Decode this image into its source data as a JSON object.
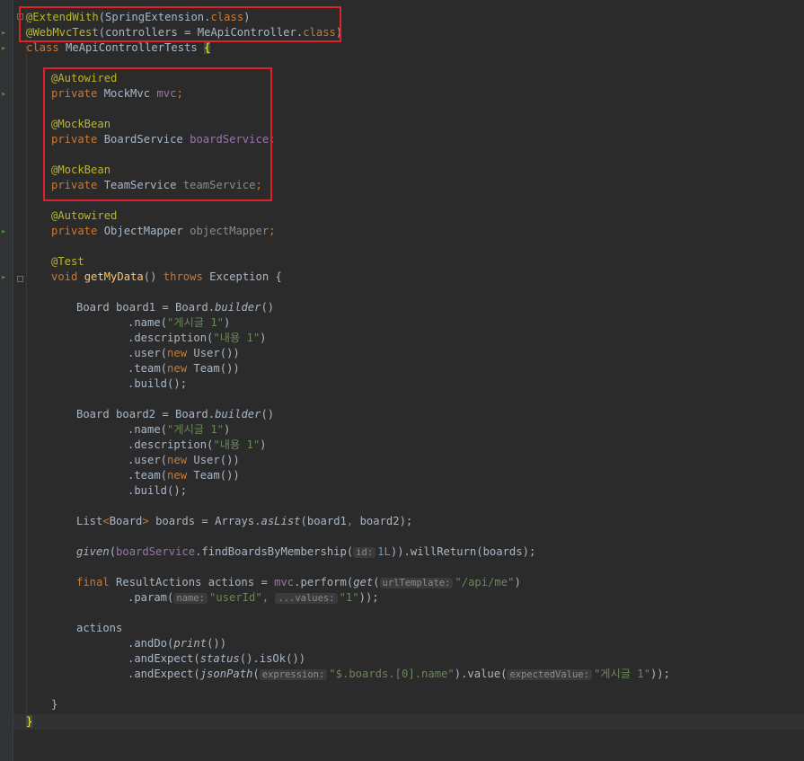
{
  "code": {
    "annotation_extend": "@ExtendWith",
    "extend_args_open": "(SpringExtension.",
    "kw_class": "class",
    "close_paren": ")",
    "annotation_webmvc": "@WebMvcTest",
    "webmvc_args": "(controllers = MeApiController.",
    "class_decl_kw": "class",
    "class_name": " MeApiControllerTests ",
    "open_brace": "{",
    "autowired": "@Autowired",
    "mockbean": "@MockBean",
    "private": "private",
    "mockmvc_type": " MockMvc ",
    "mvc_field": "mvc",
    "semicolon": ";",
    "boardservice_type": " BoardService ",
    "boardservice_field": "boardService",
    "teamservice_type": " TeamService ",
    "teamservice_field": "teamService",
    "objectmapper_type": " ObjectMapper ",
    "objectmapper_field": "objectMapper",
    "test_annotation": "@Test",
    "void": "void",
    "method_name": "getMyData",
    "method_parens": "() ",
    "throws": "throws",
    "exception": " Exception {",
    "board1_decl": "Board board1 = Board.",
    "builder": "builder",
    "parens": "()",
    "name_call": ".name(",
    "name_value": "\"게시글 1\"",
    "description_call": ".description(",
    "description_value": "\"내용 1\"",
    "user_call": ".user(",
    "new": "new",
    "user_ctor": " User())",
    "team_call": ".team(",
    "team_ctor": " Team())",
    "build_call": ".build();",
    "board2_decl": "Board board2 = Board.",
    "list_decl_1": "List",
    "lt": "<",
    "board_type": "Board",
    "gt": ">",
    "list_decl_2": " boards = Arrays.",
    "aslist": "asList",
    "aslist_args_1": "(board1",
    "comma": ",",
    "aslist_args_2": " board2);",
    "given": "given",
    "given_open": "(",
    "find_call": ".findBoardsByMembership(",
    "hint_id": "id:",
    "id_value": "1L",
    "given_close": ")).willReturn(boards);",
    "final": "final",
    "result_decl": " ResultActions actions = ",
    "perform_call": ".perform(",
    "get": "get",
    "hint_url": "urlTemplate:",
    "url_value": "\"/api/me\"",
    "param_call": ".param(",
    "hint_name": "name:",
    "userid_value": "\"userId\"",
    "hint_values": "...values:",
    "one_value": "\"1\"",
    "param_close": "));",
    "actions": "actions",
    "anddo_call": ".andDo(",
    "print": "print",
    "print_close": "())",
    "andexpect_call": ".andExpect(",
    "status": "status",
    "status_close": "().isOk())",
    "jsonpath": "jsonPath",
    "hint_expression": "expression:",
    "jsonpath_value": "\"$.boards.[0].name\"",
    "value_call": ").value(",
    "hint_expected": "expectedValue:",
    "expected_value": "\"게시글 1\"",
    "final_close": "));",
    "method_close": "}",
    "class_close": "}"
  },
  "colors": {
    "background": "#2b2b2b",
    "annotation": "#bbb529",
    "keyword": "#cc7832",
    "field": "#9876aa",
    "string": "#6a8759",
    "method": "#ffc66d",
    "highlight_box": "#e0202a"
  },
  "gutter_icons": [
    "run-test-icon",
    "bean-icon",
    "autowire-icon"
  ]
}
